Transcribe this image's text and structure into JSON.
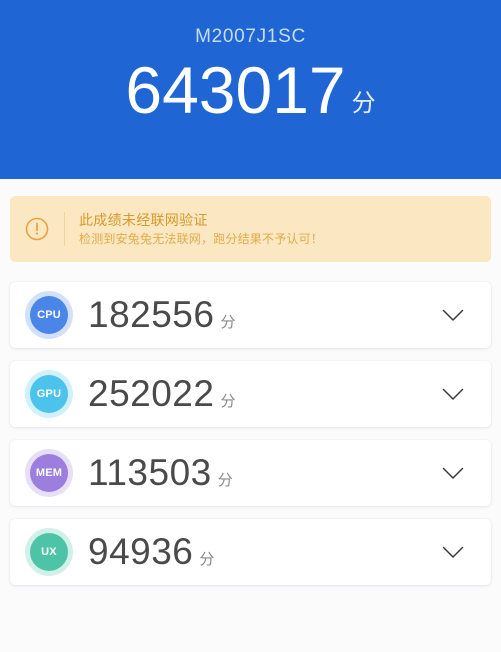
{
  "header": {
    "device_name": "M2007J1SC",
    "total_score": "643017",
    "score_unit": "分",
    "background_color": "#1f66d4"
  },
  "warning": {
    "icon": "exclamation-circle-icon",
    "title": "此成绩未经联网验证",
    "detail": "检测到安兔兔无法联网，跑分结果不予认可！",
    "background_color": "#fbe7c2",
    "text_color": "#d69a2b"
  },
  "scores": [
    {
      "key": "cpu",
      "badge_label": "CPU",
      "value": "182556",
      "unit": "分",
      "color": "#4a86e8",
      "expand_icon": "chevron-down-icon"
    },
    {
      "key": "gpu",
      "badge_label": "GPU",
      "value": "252022",
      "unit": "分",
      "color": "#4bc3ea",
      "expand_icon": "chevron-down-icon"
    },
    {
      "key": "mem",
      "badge_label": "MEM",
      "value": "113503",
      "unit": "分",
      "color": "#9b7ede",
      "expand_icon": "chevron-down-icon"
    },
    {
      "key": "ux",
      "badge_label": "UX",
      "value": "94936",
      "unit": "分",
      "color": "#4dc4a8",
      "expand_icon": "chevron-down-icon"
    }
  ]
}
